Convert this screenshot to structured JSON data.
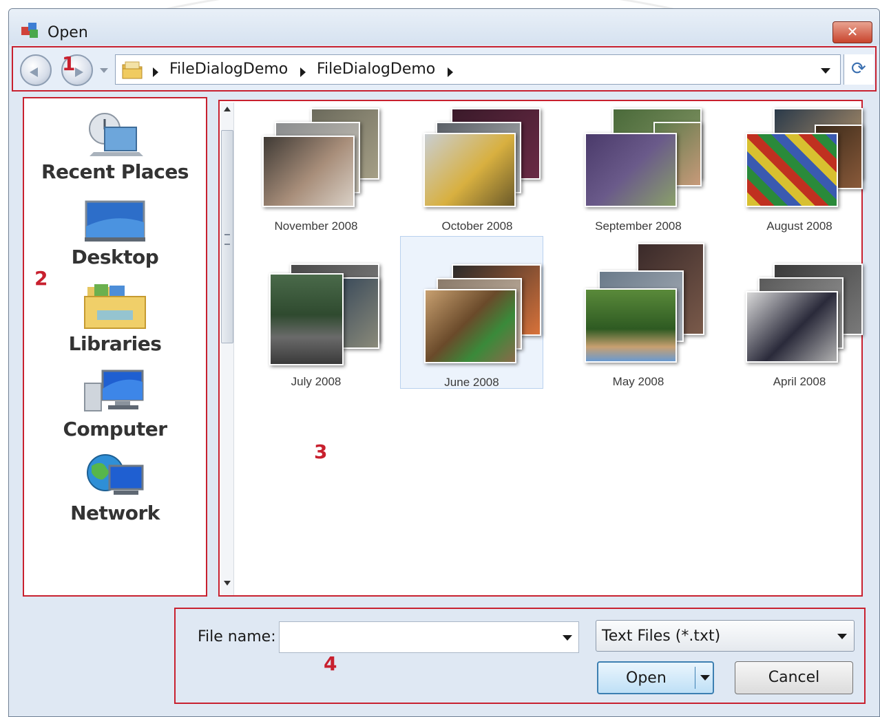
{
  "window": {
    "title": "Open",
    "close_glyph": "✕"
  },
  "nav": {
    "back_icon": "back-arrow-icon",
    "forward_icon": "forward-arrow-icon",
    "breadcrumbs": [
      "FileDialogDemo",
      "FileDialogDemo"
    ],
    "refresh_glyph": "⟳"
  },
  "places": [
    {
      "label": "Recent Places",
      "icon": "recent-places-icon"
    },
    {
      "label": "Desktop",
      "icon": "desktop-icon"
    },
    {
      "label": "Libraries",
      "icon": "libraries-icon"
    },
    {
      "label": "Computer",
      "icon": "computer-icon"
    },
    {
      "label": "Network",
      "icon": "network-icon"
    }
  ],
  "folders": [
    {
      "label": "November 2008",
      "selected": false
    },
    {
      "label": "October 2008",
      "selected": false
    },
    {
      "label": "September 2008",
      "selected": false
    },
    {
      "label": "August 2008",
      "selected": false
    },
    {
      "label": "July 2008",
      "selected": false
    },
    {
      "label": "June 2008",
      "selected": true
    },
    {
      "label": "May 2008",
      "selected": false
    },
    {
      "label": "April 2008",
      "selected": false
    }
  ],
  "bottom": {
    "file_name_label": "File name:",
    "file_name_value": "",
    "filter_value": "Text Files (*.txt)",
    "open_label": "Open",
    "cancel_label": "Cancel"
  },
  "callouts": [
    "1",
    "2",
    "3",
    "4"
  ],
  "colors": {
    "callout_red": "#c8202e",
    "accent_blue": "#3c7fb1"
  }
}
